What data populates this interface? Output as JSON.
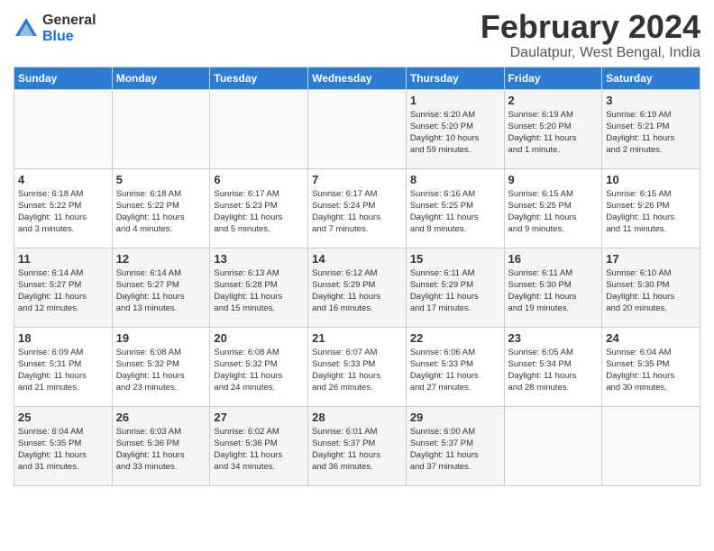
{
  "logo": {
    "general": "General",
    "blue": "Blue"
  },
  "title": {
    "month_year": "February 2024",
    "location": "Daulatpur, West Bengal, India"
  },
  "headers": [
    "Sunday",
    "Monday",
    "Tuesday",
    "Wednesday",
    "Thursday",
    "Friday",
    "Saturday"
  ],
  "weeks": [
    [
      {
        "day": "",
        "info": ""
      },
      {
        "day": "",
        "info": ""
      },
      {
        "day": "",
        "info": ""
      },
      {
        "day": "",
        "info": ""
      },
      {
        "day": "1",
        "info": "Sunrise: 6:20 AM\nSunset: 5:20 PM\nDaylight: 10 hours\nand 59 minutes."
      },
      {
        "day": "2",
        "info": "Sunrise: 6:19 AM\nSunset: 5:20 PM\nDaylight: 11 hours\nand 1 minute."
      },
      {
        "day": "3",
        "info": "Sunrise: 6:19 AM\nSunset: 5:21 PM\nDaylight: 11 hours\nand 2 minutes."
      }
    ],
    [
      {
        "day": "4",
        "info": "Sunrise: 6:18 AM\nSunset: 5:22 PM\nDaylight: 11 hours\nand 3 minutes."
      },
      {
        "day": "5",
        "info": "Sunrise: 6:18 AM\nSunset: 5:22 PM\nDaylight: 11 hours\nand 4 minutes."
      },
      {
        "day": "6",
        "info": "Sunrise: 6:17 AM\nSunset: 5:23 PM\nDaylight: 11 hours\nand 5 minutes."
      },
      {
        "day": "7",
        "info": "Sunrise: 6:17 AM\nSunset: 5:24 PM\nDaylight: 11 hours\nand 7 minutes."
      },
      {
        "day": "8",
        "info": "Sunrise: 6:16 AM\nSunset: 5:25 PM\nDaylight: 11 hours\nand 8 minutes."
      },
      {
        "day": "9",
        "info": "Sunrise: 6:15 AM\nSunset: 5:25 PM\nDaylight: 11 hours\nand 9 minutes."
      },
      {
        "day": "10",
        "info": "Sunrise: 6:15 AM\nSunset: 5:26 PM\nDaylight: 11 hours\nand 11 minutes."
      }
    ],
    [
      {
        "day": "11",
        "info": "Sunrise: 6:14 AM\nSunset: 5:27 PM\nDaylight: 11 hours\nand 12 minutes."
      },
      {
        "day": "12",
        "info": "Sunrise: 6:14 AM\nSunset: 5:27 PM\nDaylight: 11 hours\nand 13 minutes."
      },
      {
        "day": "13",
        "info": "Sunrise: 6:13 AM\nSunset: 5:28 PM\nDaylight: 11 hours\nand 15 minutes."
      },
      {
        "day": "14",
        "info": "Sunrise: 6:12 AM\nSunset: 5:29 PM\nDaylight: 11 hours\nand 16 minutes."
      },
      {
        "day": "15",
        "info": "Sunrise: 6:11 AM\nSunset: 5:29 PM\nDaylight: 11 hours\nand 17 minutes."
      },
      {
        "day": "16",
        "info": "Sunrise: 6:11 AM\nSunset: 5:30 PM\nDaylight: 11 hours\nand 19 minutes."
      },
      {
        "day": "17",
        "info": "Sunrise: 6:10 AM\nSunset: 5:30 PM\nDaylight: 11 hours\nand 20 minutes."
      }
    ],
    [
      {
        "day": "18",
        "info": "Sunrise: 6:09 AM\nSunset: 5:31 PM\nDaylight: 11 hours\nand 21 minutes."
      },
      {
        "day": "19",
        "info": "Sunrise: 6:08 AM\nSunset: 5:32 PM\nDaylight: 11 hours\nand 23 minutes."
      },
      {
        "day": "20",
        "info": "Sunrise: 6:08 AM\nSunset: 5:32 PM\nDaylight: 11 hours\nand 24 minutes."
      },
      {
        "day": "21",
        "info": "Sunrise: 6:07 AM\nSunset: 5:33 PM\nDaylight: 11 hours\nand 26 minutes."
      },
      {
        "day": "22",
        "info": "Sunrise: 6:06 AM\nSunset: 5:33 PM\nDaylight: 11 hours\nand 27 minutes."
      },
      {
        "day": "23",
        "info": "Sunrise: 6:05 AM\nSunset: 5:34 PM\nDaylight: 11 hours\nand 28 minutes."
      },
      {
        "day": "24",
        "info": "Sunrise: 6:04 AM\nSunset: 5:35 PM\nDaylight: 11 hours\nand 30 minutes."
      }
    ],
    [
      {
        "day": "25",
        "info": "Sunrise: 6:04 AM\nSunset: 5:35 PM\nDaylight: 11 hours\nand 31 minutes."
      },
      {
        "day": "26",
        "info": "Sunrise: 6:03 AM\nSunset: 5:36 PM\nDaylight: 11 hours\nand 33 minutes."
      },
      {
        "day": "27",
        "info": "Sunrise: 6:02 AM\nSunset: 5:36 PM\nDaylight: 11 hours\nand 34 minutes."
      },
      {
        "day": "28",
        "info": "Sunrise: 6:01 AM\nSunset: 5:37 PM\nDaylight: 11 hours\nand 36 minutes."
      },
      {
        "day": "29",
        "info": "Sunrise: 6:00 AM\nSunset: 5:37 PM\nDaylight: 11 hours\nand 37 minutes."
      },
      {
        "day": "",
        "info": ""
      },
      {
        "day": "",
        "info": ""
      }
    ]
  ]
}
